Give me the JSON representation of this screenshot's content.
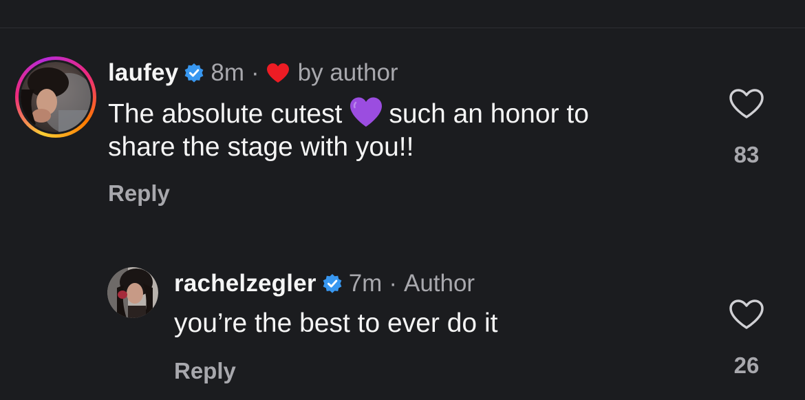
{
  "comments": [
    {
      "username": "laufey",
      "verified": true,
      "time": "8m",
      "separator": "·",
      "liked_by_author_label": "by author",
      "text_before_emoji": "The absolute cutest",
      "emoji": "purple-heart",
      "text_after_emoji": "such an honor to",
      "text_line2": "share the stage with you!!",
      "reply_label": "Reply",
      "like_count": "83",
      "avatar": "profile-photo",
      "story_ring": true
    },
    {
      "username": "rachelzegler",
      "verified": true,
      "time": "7m",
      "separator": "·",
      "author_badge": "Author",
      "text": "you’re the best to ever do it",
      "reply_label": "Reply",
      "like_count": "26",
      "avatar": "profile-photo"
    }
  ],
  "colors": {
    "background": "#1b1c1f",
    "text_primary": "#f5f5f5",
    "text_secondary": "#a8a8ad",
    "verified_blue": "#3897f0",
    "red_heart": "#ed1c24",
    "purple_heart": "#9b4de0"
  },
  "icons": [
    "chevron-down-icon",
    "verified-badge-icon",
    "red-heart-icon",
    "purple-heart-emoji",
    "like-heart-icon"
  ]
}
